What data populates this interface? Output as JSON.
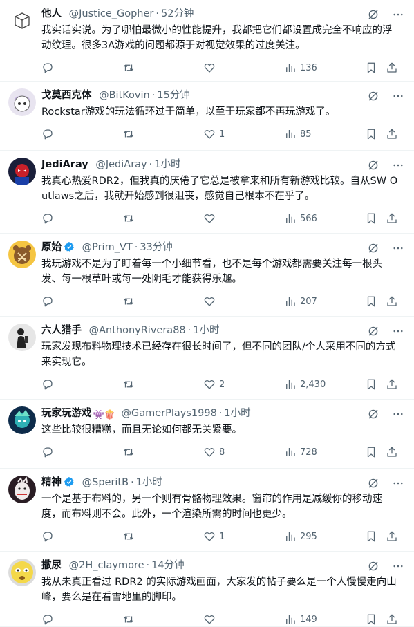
{
  "tweets": [
    {
      "name": "他人",
      "handle": "@Justice_Gopher",
      "time": "52分钟",
      "verified": false,
      "emoji": "",
      "text": "我实话实说。为了哪怕最微小的性能提升，我都把它们都设置成完全不响应的浮动纹理。很多3A游戏的问题都源于对视觉效果的过度关注。",
      "likes": "",
      "views": "136"
    },
    {
      "name": "戈莫西克体",
      "handle": "@BitKovin",
      "time": "15分钟",
      "verified": false,
      "emoji": "",
      "text": "Rockstar游戏的玩法循环过于简单，以至于玩家都不再玩游戏了。",
      "likes": "1",
      "views": "85"
    },
    {
      "name": "JediAray",
      "handle": "@JediAray",
      "time": "1小时",
      "verified": false,
      "emoji": "",
      "text": "我真心热爱RDR2，但我真的厌倦了它总是被拿来和所有新游戏比较。自从SW Outlaws之后，我就开始感到很沮丧，感觉自己根本不在乎了。",
      "likes": "",
      "views": "566"
    },
    {
      "name": "原始",
      "handle": "@Prim_VT",
      "time": "33分钟",
      "verified": true,
      "emoji": "",
      "text": "我玩游戏不是为了盯着每一个小细节看，也不是每个游戏都需要关注每一根头发、每一根草叶或每一处阴毛才能获得乐趣。",
      "likes": "",
      "views": "207"
    },
    {
      "name": "六人猎手",
      "handle": "@AnthonyRivera88",
      "time": "1小时",
      "verified": false,
      "emoji": "",
      "text": "玩家发现布料物理技术已经存在很长时间了，但不同的团队/个人采用不同的方式来实现它。",
      "likes": "2",
      "views": "2,430"
    },
    {
      "name": "玩家玩游戏",
      "handle": "@GamerPlays1998",
      "time": "1小时",
      "verified": false,
      "emoji": "👾🍿",
      "text": "这些比较很糟糕，而且无论如何都无关紧要。",
      "likes": "8",
      "views": "728"
    },
    {
      "name": "精神",
      "handle": "@SperitB",
      "time": "1小时",
      "verified": true,
      "emoji": "",
      "text": "一个是基于布料的，另一个则有骨骼物理效果。窗帘的作用是减缓你的移动速度，而布料则不会。此外，一个渲染所需的时间也更少。",
      "likes": "1",
      "views": "295"
    },
    {
      "name": "撒尿",
      "handle": "@2H_claymore",
      "time": "14分钟",
      "verified": false,
      "emoji": "",
      "text": "我从未真正看过 RDR2 的实际游戏画面，大家发的帖子要么是一个人慢慢走向山峰，要么是在看雪地里的脚印。",
      "likes": "",
      "views": "149"
    }
  ],
  "separator": "·",
  "colors": {
    "accent": "#1d9bf0",
    "muted": "#536471",
    "text": "#0f1419",
    "divider": "#eff3f4"
  }
}
